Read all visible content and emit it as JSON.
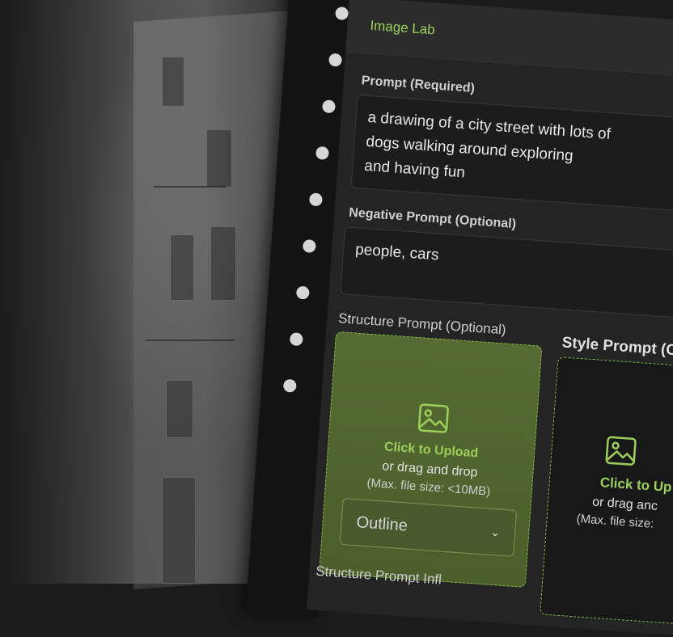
{
  "app": {
    "title": "Image Lab"
  },
  "prompt": {
    "label_main": "Prompt",
    "label_suffix": "(Required)",
    "lines": [
      "a drawing of a city street with lots of",
      "dogs walking around exploring",
      "and having fun"
    ]
  },
  "negative_prompt": {
    "label_main": "Negative Prompt",
    "label_suffix": "(Optional)",
    "value": "people, cars"
  },
  "structure_prompt": {
    "label": "Structure Prompt (Optional)",
    "upload": {
      "click": "Click to Upload",
      "or": "or drag and drop",
      "max": "(Max. file size: <10MB)"
    },
    "select_value": "Outline"
  },
  "style_prompt": {
    "label": "Style Prompt (Op",
    "upload": {
      "click": "Click to Up",
      "or": "or drag anc",
      "max": "(Max. file size:"
    }
  },
  "structure_influence": {
    "label": "Structure Prompt Infl"
  },
  "icons": {
    "upload": "image-icon",
    "chevron": "chevron-down-icon"
  },
  "colors": {
    "accent": "#9ccf5a",
    "panel_bg": "#242424",
    "upload_green": "#566a33"
  }
}
